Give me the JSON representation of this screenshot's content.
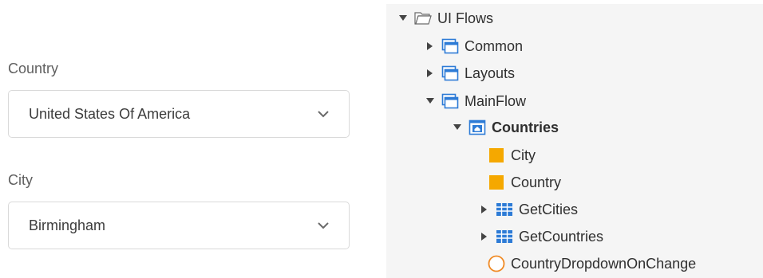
{
  "form": {
    "country": {
      "label": "Country",
      "value": "United States Of America"
    },
    "city": {
      "label": "City",
      "value": "Birmingham"
    }
  },
  "tree": {
    "root": {
      "label": "UI Flows",
      "icon": "folder-open-icon"
    },
    "common": {
      "label": "Common",
      "icon": "ui-flow-icon"
    },
    "layouts": {
      "label": "Layouts",
      "icon": "ui-flow-icon"
    },
    "mainflow": {
      "label": "MainFlow",
      "icon": "ui-flow-icon"
    },
    "countries": {
      "label": "Countries",
      "icon": "screen-home-icon"
    },
    "city_var": {
      "label": "City",
      "icon": "local-variable-icon"
    },
    "country_var": {
      "label": "Country",
      "icon": "local-variable-icon"
    },
    "getcities": {
      "label": "GetCities",
      "icon": "aggregate-icon"
    },
    "getcountries": {
      "label": "GetCountries",
      "icon": "aggregate-icon"
    },
    "onchange": {
      "label": "CountryDropdownOnChange",
      "icon": "client-action-icon"
    }
  },
  "colors": {
    "accent_blue": "#2d7bd6",
    "variable_orange": "#f5a800",
    "action_orange": "#f08a24",
    "tree_bg": "#f5f5f5"
  }
}
